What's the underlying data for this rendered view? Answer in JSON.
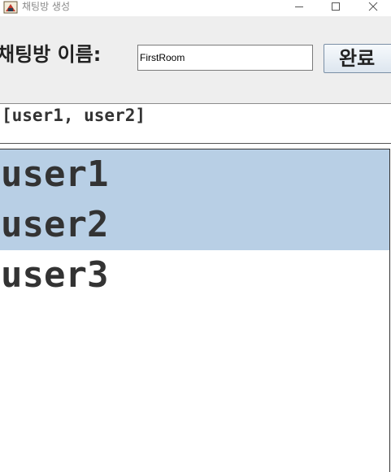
{
  "window": {
    "title": "채팅방 생성",
    "controls": {
      "minimize": "minimize-icon",
      "maximize": "maximize-icon",
      "close": "close-icon"
    }
  },
  "form": {
    "room_name_label": "채팅방 이름:",
    "room_name_value": "FirstRoom",
    "done_label": "완료"
  },
  "selected_users_text": "[user1, user2]",
  "user_list": {
    "items": [
      {
        "label": "user1",
        "selected": true
      },
      {
        "label": "user2",
        "selected": true
      },
      {
        "label": "user3",
        "selected": false
      }
    ]
  },
  "colors": {
    "selection": "#b8cfe5",
    "panel_background": "#eeeeee"
  }
}
